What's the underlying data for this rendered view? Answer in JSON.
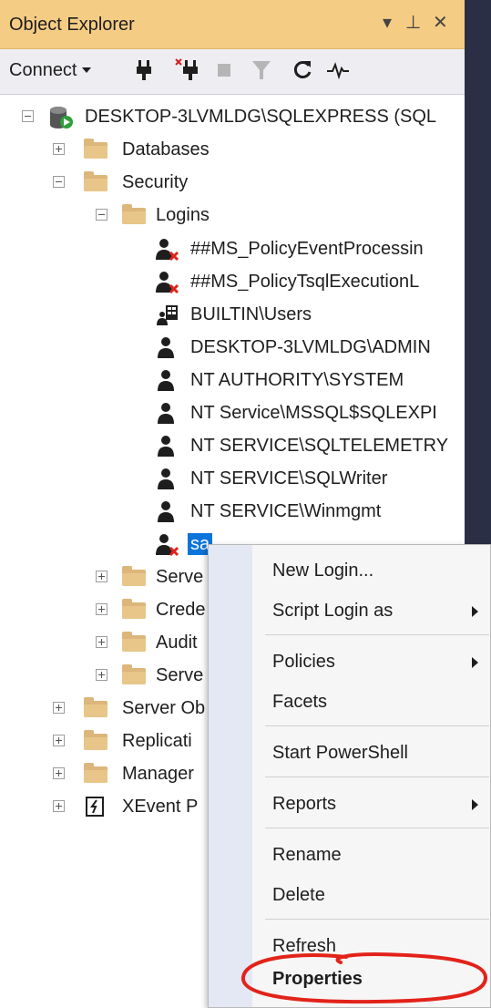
{
  "panel": {
    "title": "Object Explorer",
    "controls": {
      "dropdown": "▾",
      "pin": "⊥",
      "close": "✕"
    }
  },
  "toolbar": {
    "connect_label": "Connect",
    "buttons": [
      "connect-icon",
      "disconnect-icon",
      "stop-icon",
      "filter-icon",
      "refresh-icon",
      "activity-monitor-icon"
    ]
  },
  "tree": {
    "server": "DESKTOP-3LVMLDG\\SQLEXPRESS (SQL",
    "databases": "Databases",
    "security": "Security",
    "logins": "Logins",
    "login_items": [
      {
        "label": "##MS_PolicyEventProcessin",
        "icon": "login-disabled-icon"
      },
      {
        "label": "##MS_PolicyTsqlExecutionL",
        "icon": "login-disabled-icon"
      },
      {
        "label": "BUILTIN\\Users",
        "icon": "group-login-icon"
      },
      {
        "label": "DESKTOP-3LVMLDG\\ADMIN",
        "icon": "login-icon"
      },
      {
        "label": "NT AUTHORITY\\SYSTEM",
        "icon": "login-icon"
      },
      {
        "label": "NT Service\\MSSQL$SQLEXPI",
        "icon": "login-icon"
      },
      {
        "label": "NT SERVICE\\SQLTELEMETRY",
        "icon": "login-icon"
      },
      {
        "label": "NT SERVICE\\SQLWriter",
        "icon": "login-icon"
      },
      {
        "label": "NT SERVICE\\Winmgmt",
        "icon": "login-icon"
      },
      {
        "label": "sa",
        "icon": "login-disabled-icon",
        "selected": true
      }
    ],
    "security_children": [
      "Serve",
      "Crede",
      "Audit",
      "Serve"
    ],
    "server_children": [
      "Server Ob",
      "Replicati",
      "Manager",
      "XEvent P"
    ]
  },
  "context_menu": {
    "new_login": "New Login...",
    "script_login_as": "Script Login as",
    "policies": "Policies",
    "facets": "Facets",
    "start_powershell": "Start PowerShell",
    "reports": "Reports",
    "rename": "Rename",
    "delete": "Delete",
    "refresh": "Refresh",
    "properties": "Properties"
  },
  "colors": {
    "title_bar": "#f5cc84",
    "selection": "#0a74da",
    "annotation": "#e2231a"
  }
}
